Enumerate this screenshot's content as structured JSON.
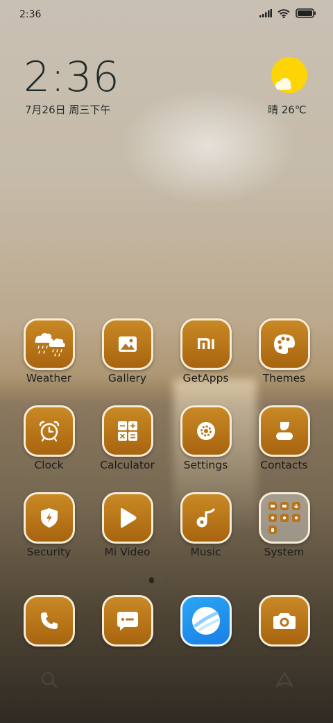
{
  "status_bar": {
    "time": "2:36"
  },
  "widget": {
    "time": "2:36",
    "date": "7月26日 周三下午",
    "weather": "晴 26℃"
  },
  "apps": [
    {
      "name": "weather",
      "label": "Weather",
      "icon": "weather-icon"
    },
    {
      "name": "gallery",
      "label": "Gallery",
      "icon": "gallery-icon"
    },
    {
      "name": "getapps",
      "label": "GetApps",
      "icon": "mi-icon"
    },
    {
      "name": "themes",
      "label": "Themes",
      "icon": "palette-icon"
    },
    {
      "name": "clock",
      "label": "Clock",
      "icon": "alarm-clock-icon"
    },
    {
      "name": "calculator",
      "label": "Calculator",
      "icon": "calculator-icon"
    },
    {
      "name": "settings",
      "label": "Settings",
      "icon": "gear-icon"
    },
    {
      "name": "contacts",
      "label": "Contacts",
      "icon": "contacts-icon"
    },
    {
      "name": "security",
      "label": "Security",
      "icon": "shield-icon"
    },
    {
      "name": "mivideo",
      "label": "Mi Video",
      "icon": "play-icon"
    },
    {
      "name": "music",
      "label": "Music",
      "icon": "music-note-icon"
    },
    {
      "name": "system",
      "label": "System",
      "icon": "folder-icon"
    }
  ],
  "dock": [
    "phone-icon",
    "messages-icon",
    "browser-icon",
    "camera-icon"
  ],
  "colors": {
    "icon_fill": "#b7731a",
    "icon_border": "#f7ecd8",
    "sun": "#fdd406"
  }
}
